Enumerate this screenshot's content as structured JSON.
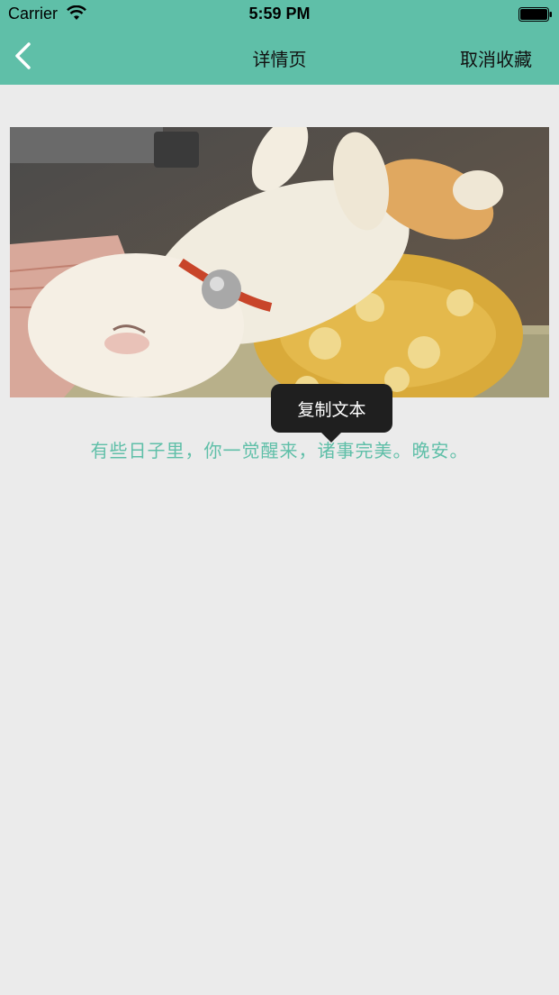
{
  "status_bar": {
    "carrier": "Carrier",
    "time": "5:59 PM",
    "wifi_icon": "wifi-icon",
    "battery_icon": "battery-icon"
  },
  "nav": {
    "back_icon": "chevron-left-icon",
    "title": "详情页",
    "right_action": "取消收藏"
  },
  "content": {
    "image_description": "sleeping-cat-photo",
    "caption": "有些日子里，你一觉醒来，诸事完美。晚安。"
  },
  "context_menu": {
    "label": "复制文本"
  },
  "colors": {
    "accent": "#5fbfa8",
    "background": "#ebebeb",
    "tooltip": "#1f1f1f"
  }
}
